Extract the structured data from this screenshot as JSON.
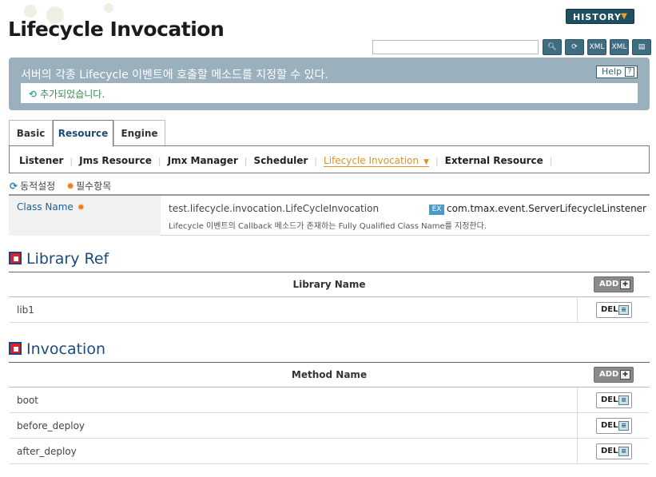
{
  "header": {
    "title": "Lifecycle Invocation",
    "history_label": "HISTORY",
    "search_placeholder": "",
    "tool_icons": [
      "search-icon",
      "refresh-icon",
      "xml-export-icon",
      "xml-import-icon",
      "save-icon"
    ]
  },
  "info": {
    "description": "서버의 각종 Lifecycle 이벤트에 호출할 메소드를 지정할 수 있다.",
    "help_label": "Help",
    "help_icon": "?",
    "message": "추가되었습니다."
  },
  "tabs": [
    {
      "label": "Basic"
    },
    {
      "label": "Resource"
    },
    {
      "label": "Engine"
    }
  ],
  "subnav": [
    {
      "label": "Listener"
    },
    {
      "label": "Jms Resource"
    },
    {
      "label": "Jmx Manager"
    },
    {
      "label": "Scheduler"
    },
    {
      "label": "Lifecycle Invocation"
    },
    {
      "label": "External Resource"
    }
  ],
  "legend": {
    "dynamic": "동적설정",
    "required": "필수항목"
  },
  "form": {
    "class_name_label": "Class Name",
    "class_name_value": "test.lifecycle.invocation.LifeCycleInvocation",
    "example_badge": "EX",
    "example_value": "com.tmax.event.ServerLifecycleLinstener",
    "hint": "Lifecycle 이벤트의 Callback 메소드가 존재하는 Fully Qualified Class Name를 지정한다."
  },
  "library_ref": {
    "title": "Library Ref",
    "column": "Library Name",
    "add_label": "ADD",
    "rows": [
      {
        "name": "lib1",
        "del_label": "DEL"
      }
    ]
  },
  "invocation": {
    "title": "Invocation",
    "column": "Method Name",
    "add_label": "ADD",
    "rows": [
      {
        "name": "boot",
        "del_label": "DEL"
      },
      {
        "name": "before_deploy",
        "del_label": "DEL"
      },
      {
        "name": "after_deploy",
        "del_label": "DEL"
      }
    ]
  },
  "colors": {
    "info_bg": "#9ab0bd",
    "accent": "#1d4b7e",
    "active_sub": "#d9932a",
    "history_bg": "#1f4f60"
  }
}
